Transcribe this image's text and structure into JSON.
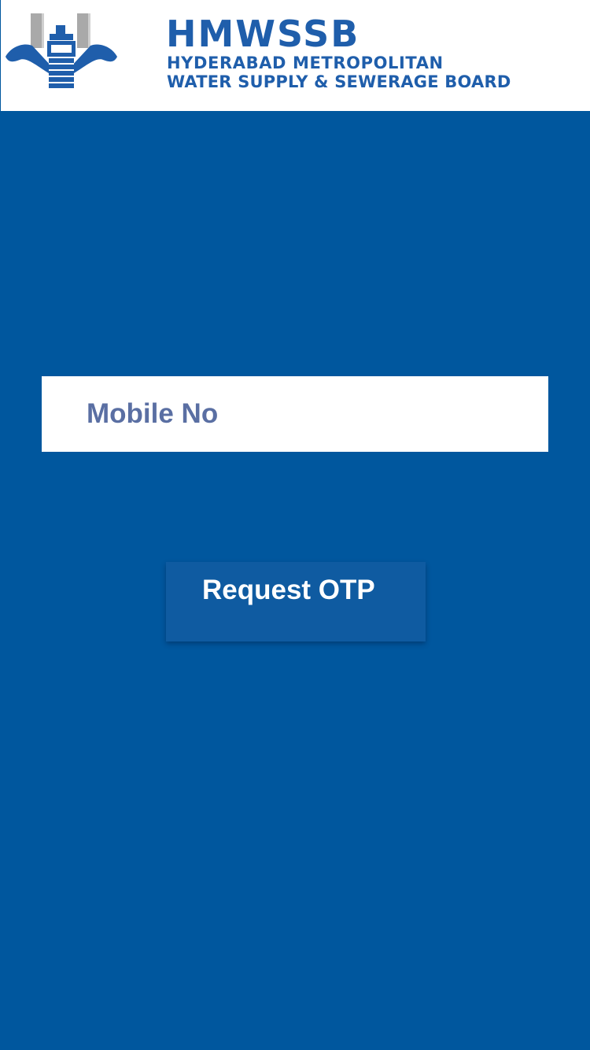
{
  "header": {
    "logo_icon": "hmwssb-tap-logo-icon",
    "title": "HMWSSB",
    "subtitle_line1": "HYDERABAD METROPOLITAN",
    "subtitle_line2": "WATER SUPPLY & SEWERAGE BOARD"
  },
  "form": {
    "mobile_placeholder": "Mobile No",
    "mobile_value": "",
    "request_otp_label": "Request OTP"
  },
  "colors": {
    "background": "#00579e",
    "brand_blue": "#1f5eab",
    "button": "#0f5ba1",
    "field_text": "#5a6fa3"
  }
}
